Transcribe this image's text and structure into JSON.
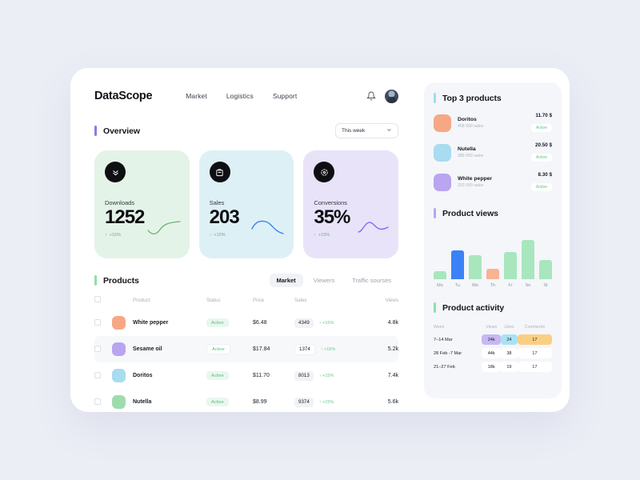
{
  "header": {
    "logo": "DataScope",
    "nav": [
      {
        "label": "Market"
      },
      {
        "label": "Logistics"
      },
      {
        "label": "Support"
      }
    ],
    "bell_icon": "bell-icon",
    "avatar_icon": "user-avatar"
  },
  "overview": {
    "title": "Overview",
    "accent": "#8c7ae6",
    "period_value": "This week",
    "cards": [
      {
        "label": "Downloads",
        "value": "1252",
        "delta": "+15%",
        "icon": "download-icon",
        "bg": "#e4f3e7",
        "line": "#6fae78",
        "delta_color": "#6fae78"
      },
      {
        "label": "Sales",
        "value": "203",
        "delta": "+15%",
        "icon": "shopping-bag-icon",
        "bg": "#ddf0f5",
        "line": "#3b82f6",
        "delta_color": "#6fae78"
      },
      {
        "label": "Conversions",
        "value": "35%",
        "delta": "+15%",
        "icon": "target-icon",
        "bg": "#e8e3f8",
        "line": "#8b5cf6",
        "delta_color": "#6fae78"
      }
    ]
  },
  "products": {
    "title": "Products",
    "accent": "#8fe0a8",
    "tabs": [
      {
        "label": "Market",
        "active": true
      },
      {
        "label": "Viewers",
        "active": false
      },
      {
        "label": "Traffic sourses",
        "active": false
      }
    ],
    "columns": [
      "",
      "",
      "Product",
      "Status",
      "Price",
      "Sales",
      "Views"
    ],
    "rows": [
      {
        "name": "White pepper",
        "status": "Active",
        "price": "$6.48",
        "sales": "4349",
        "delta": "+15%",
        "views": "4.8k",
        "color": "#f6a885",
        "highlight": false
      },
      {
        "name": "Sesame oil",
        "status": "Active",
        "price": "$17.84",
        "sales": "1374",
        "delta": "+15%",
        "views": "5.2k",
        "color": "#b9a5f0",
        "highlight": true
      },
      {
        "name": "Doritos",
        "status": "Active",
        "price": "$11.70",
        "sales": "8013",
        "delta": "+15%",
        "views": "7.4k",
        "color": "#a8dcf0",
        "highlight": false
      },
      {
        "name": "Nutella",
        "status": "Active",
        "price": "$8.99",
        "sales": "9374",
        "delta": "+15%",
        "views": "5.6k",
        "color": "#9edcae",
        "highlight": false
      }
    ]
  },
  "top_products": {
    "title": "Top 3 products",
    "accent": "#9ce0ee",
    "items": [
      {
        "name": "Doritos",
        "sales": "458 000 sales",
        "price": "11.70 $",
        "status": "Active",
        "color": "#f6a885"
      },
      {
        "name": "Nutella",
        "sales": "389 000 sales",
        "price": "20.50 $",
        "status": "Active",
        "color": "#a8dcf0"
      },
      {
        "name": "White pepper",
        "sales": "253 000 sales",
        "price": "8.30 $",
        "status": "Active",
        "color": "#b9a5f0"
      }
    ]
  },
  "product_views": {
    "title": "Product views",
    "accent": "#b9a5f0",
    "chart_data": {
      "type": "bar",
      "title": "Product views",
      "categories": [
        "Mo",
        "Tu",
        "We",
        "Th",
        "Fr",
        "Sn",
        "St"
      ],
      "values": [
        18,
        62,
        52,
        22,
        58,
        84,
        42
      ],
      "colors": [
        "#a8e6bd",
        "#3b82f6",
        "#a8e6bd",
        "#f8b393",
        "#a8e6bd",
        "#a8e6bd",
        "#a8e6bd"
      ],
      "xlabel": "",
      "ylabel": "",
      "ylim": [
        0,
        100
      ],
      "grid": false,
      "legend": false
    }
  },
  "product_activity": {
    "title": "Product activity",
    "accent": "#8fe0a8",
    "columns": [
      "Week",
      "Views",
      "Likes",
      "Comments"
    ],
    "rows": [
      {
        "week": "7–14 Mar",
        "views": "24k",
        "likes": "24",
        "comments": "17",
        "views_bg": "#c7b8f2",
        "likes_bg": "#a9e2f4",
        "comments_bg": "#fbcf83"
      },
      {
        "week": "28 Feb -7 Mar",
        "views": "44k",
        "likes": "38",
        "comments": "17",
        "views_bg": "#ffffff",
        "likes_bg": "#ffffff",
        "comments_bg": "#ffffff"
      },
      {
        "week": "21–27 Feb",
        "views": "18k",
        "likes": "19",
        "comments": "17",
        "views_bg": "#ffffff",
        "likes_bg": "#ffffff",
        "comments_bg": "#ffffff"
      }
    ]
  }
}
